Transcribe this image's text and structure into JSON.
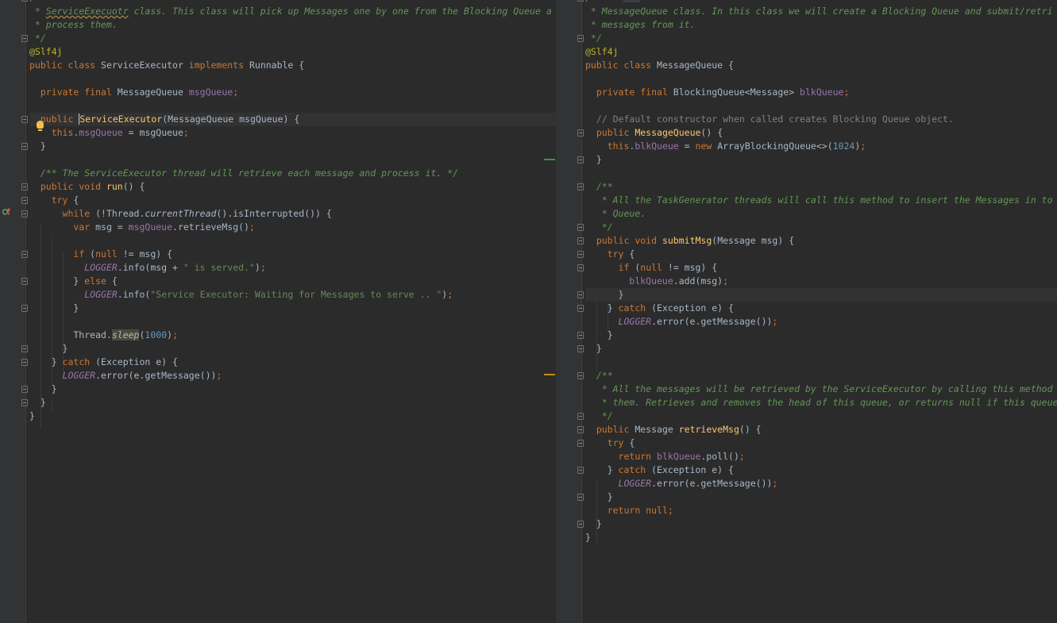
{
  "editor": {
    "left_file": {
      "lines": [
        [
          [
            "lc",
            "/**"
          ]
        ],
        [
          [
            "cm",
            " * "
          ],
          [
            "cm-warn",
            "ServiceExecuotr"
          ],
          [
            "cm",
            " class. This class will pick up Messages one by one from the Blocking Queue a"
          ]
        ],
        [
          [
            "cm",
            " * process them."
          ]
        ],
        [
          [
            "cm",
            " */"
          ]
        ],
        [
          [
            "an",
            "@Slf4j"
          ]
        ],
        [
          [
            "kw",
            "public class "
          ],
          [
            "",
            "ServiceExecutor "
          ],
          [
            "kw",
            "implements "
          ],
          [
            "",
            "Runnable {"
          ]
        ],
        [],
        [
          [
            "",
            "  "
          ],
          [
            "kw",
            "private final "
          ],
          [
            "",
            "MessageQueue "
          ],
          [
            "fd",
            "msgQueue"
          ],
          [
            "kw",
            ";"
          ]
        ],
        [],
        [
          [
            "",
            "  "
          ],
          [
            "kw",
            "public "
          ],
          [
            "caret",
            ""
          ],
          [
            "fnhl",
            "ServiceExecutor"
          ],
          [
            "",
            "(MessageQueue msgQueue) {"
          ]
        ],
        [
          [
            "",
            "    "
          ],
          [
            "kw",
            "this"
          ],
          [
            "",
            "."
          ],
          [
            "fd",
            "msgQueue"
          ],
          [
            "",
            " = msgQueue"
          ],
          [
            "kw",
            ";"
          ]
        ],
        [
          [
            "",
            "  }"
          ]
        ],
        [],
        [
          [
            "",
            "  "
          ],
          [
            "cm",
            "/** The ServiceExecutor thread will retrieve each message and process it. */"
          ]
        ],
        [
          [
            "",
            "  "
          ],
          [
            "kw",
            "public void "
          ],
          [
            "fn",
            "run"
          ],
          [
            "",
            "() {"
          ]
        ],
        [
          [
            "",
            "    "
          ],
          [
            "kw",
            "try "
          ],
          [
            "",
            "{"
          ]
        ],
        [
          [
            "",
            "      "
          ],
          [
            "kw",
            "while "
          ],
          [
            "",
            "(!Thread."
          ],
          [
            "sm",
            "currentThread"
          ],
          [
            "",
            "().isInterrupted()) {"
          ]
        ],
        [
          [
            "",
            "        "
          ],
          [
            "kw",
            "var "
          ],
          [
            "",
            "msg = "
          ],
          [
            "fd",
            "msgQueue"
          ],
          [
            "",
            ".retrieveMsg()"
          ],
          [
            "kw",
            ";"
          ]
        ],
        [],
        [
          [
            "",
            "        "
          ],
          [
            "kw",
            "if "
          ],
          [
            "",
            "("
          ],
          [
            "kw",
            "null "
          ],
          [
            "",
            "!= msg) {"
          ]
        ],
        [
          [
            "",
            "          "
          ],
          [
            "st",
            "LOGGER"
          ],
          [
            "",
            ".info(msg + "
          ],
          [
            "str",
            "\" is served.\""
          ],
          [
            "",
            ")"
          ],
          [
            "kw",
            ";"
          ]
        ],
        [
          [
            "",
            "        } "
          ],
          [
            "kw",
            "else "
          ],
          [
            "",
            "{"
          ]
        ],
        [
          [
            "",
            "          "
          ],
          [
            "st",
            "LOGGER"
          ],
          [
            "",
            ".info("
          ],
          [
            "str",
            "\"Service Executor: Waiting for Messages to serve .. \""
          ],
          [
            "",
            ")"
          ],
          [
            "kw",
            ";"
          ]
        ],
        [
          [
            "",
            "        }"
          ]
        ],
        [],
        [
          [
            "",
            "        Thread."
          ],
          [
            "smhl",
            "sleep"
          ],
          [
            "",
            "("
          ],
          [
            "num",
            "1000"
          ],
          [
            "",
            ")"
          ],
          [
            "kw",
            ";"
          ]
        ],
        [
          [
            "",
            "      }"
          ]
        ],
        [
          [
            "",
            "    } "
          ],
          [
            "kw",
            "catch "
          ],
          [
            "",
            "(Exception e) {"
          ]
        ],
        [
          [
            "",
            "      "
          ],
          [
            "st",
            "LOGGER"
          ],
          [
            "",
            ".error(e.getMessage())"
          ],
          [
            "kw",
            ";"
          ]
        ],
        [
          [
            "",
            "    }"
          ]
        ],
        [
          [
            "",
            "  }"
          ]
        ],
        [
          [
            "",
            "}"
          ]
        ]
      ]
    },
    "right_file": {
      "lines": [
        [
          [
            "lc",
            "/**"
          ]
        ],
        [
          [
            "cm",
            " * MessageQueue class. In this class we will create a Blocking Queue and submit/retri"
          ]
        ],
        [
          [
            "cm",
            " * messages from it."
          ]
        ],
        [
          [
            "cm",
            " */"
          ]
        ],
        [
          [
            "an",
            "@Slf4j"
          ]
        ],
        [
          [
            "kw",
            "public class "
          ],
          [
            "",
            "MessageQueue {"
          ]
        ],
        [],
        [
          [
            "",
            "  "
          ],
          [
            "kw",
            "private final "
          ],
          [
            "",
            "BlockingQueue<Message> "
          ],
          [
            "fd",
            "blkQueue"
          ],
          [
            "kw",
            ";"
          ]
        ],
        [],
        [
          [
            "",
            "  "
          ],
          [
            "lc",
            "// Default constructor when called creates Blocking Queue object."
          ]
        ],
        [
          [
            "",
            "  "
          ],
          [
            "kw",
            "public "
          ],
          [
            "fn",
            "MessageQueue"
          ],
          [
            "",
            "() {"
          ]
        ],
        [
          [
            "",
            "    "
          ],
          [
            "kw",
            "this"
          ],
          [
            "",
            "."
          ],
          [
            "fd",
            "blkQueue"
          ],
          [
            "",
            " = "
          ],
          [
            "kw",
            "new "
          ],
          [
            "",
            "ArrayBlockingQueue<>("
          ],
          [
            "num",
            "1024"
          ],
          [
            "",
            ")"
          ],
          [
            "kw",
            ";"
          ]
        ],
        [
          [
            "",
            "  }"
          ]
        ],
        [],
        [
          [
            "",
            "  "
          ],
          [
            "cm",
            "/**"
          ]
        ],
        [
          [
            "",
            "  "
          ],
          [
            "cm",
            " * All the TaskGenerator threads will call this method to insert the Messages in to"
          ]
        ],
        [
          [
            "",
            "  "
          ],
          [
            "cm",
            " * Queue."
          ]
        ],
        [
          [
            "",
            "  "
          ],
          [
            "cm",
            " */"
          ]
        ],
        [
          [
            "",
            "  "
          ],
          [
            "kw",
            "public void "
          ],
          [
            "fn",
            "submitMsg"
          ],
          [
            "",
            "(Message msg) {"
          ]
        ],
        [
          [
            "",
            "    "
          ],
          [
            "kw",
            "try "
          ],
          [
            "",
            "{"
          ]
        ],
        [
          [
            "",
            "      "
          ],
          [
            "kw",
            "if "
          ],
          [
            "",
            "("
          ],
          [
            "kw",
            "null "
          ],
          [
            "",
            "!= msg) {"
          ]
        ],
        [
          [
            "",
            "        "
          ],
          [
            "fd",
            "blkQueue"
          ],
          [
            "",
            ".add(msg)"
          ],
          [
            "kw",
            ";"
          ]
        ],
        [
          [
            "",
            "      }"
          ]
        ],
        [
          [
            "",
            "    } "
          ],
          [
            "kw",
            "catch "
          ],
          [
            "",
            "(Exception e) {"
          ]
        ],
        [
          [
            "",
            "      "
          ],
          [
            "st",
            "LOGGER"
          ],
          [
            "",
            ".error(e.getMessage())"
          ],
          [
            "kw",
            ";"
          ]
        ],
        [
          [
            "",
            "    }"
          ]
        ],
        [
          [
            "",
            "  }"
          ]
        ],
        [],
        [
          [
            "",
            "  "
          ],
          [
            "cm",
            "/**"
          ]
        ],
        [
          [
            "",
            "  "
          ],
          [
            "cm",
            " * All the messages will be retrieved by the ServiceExecutor by calling this method"
          ]
        ],
        [
          [
            "",
            "  "
          ],
          [
            "cm",
            " * them. Retrieves and removes the head of this queue, or returns null if this queue"
          ]
        ],
        [
          [
            "",
            "  "
          ],
          [
            "cm",
            " */"
          ]
        ],
        [
          [
            "",
            "  "
          ],
          [
            "kw",
            "public "
          ],
          [
            "",
            "Message "
          ],
          [
            "fn",
            "retrieveMsg"
          ],
          [
            "",
            "() {"
          ]
        ],
        [
          [
            "",
            "    "
          ],
          [
            "kw",
            "try "
          ],
          [
            "",
            "{"
          ]
        ],
        [
          [
            "",
            "      "
          ],
          [
            "kw",
            "return "
          ],
          [
            "fd",
            "blkQueue"
          ],
          [
            "",
            ".poll()"
          ],
          [
            "kw",
            ";"
          ]
        ],
        [
          [
            "",
            "    } "
          ],
          [
            "kw",
            "catch "
          ],
          [
            "",
            "(Exception e) {"
          ]
        ],
        [
          [
            "",
            "      "
          ],
          [
            "st",
            "LOGGER"
          ],
          [
            "",
            ".error(e.getMessage())"
          ],
          [
            "kw",
            ";"
          ]
        ],
        [
          [
            "",
            "    }"
          ]
        ],
        [
          [
            "",
            "    "
          ],
          [
            "kw",
            "return null;"
          ]
        ],
        [
          [
            "",
            "  }"
          ]
        ],
        [
          [
            "",
            "}"
          ]
        ]
      ]
    }
  }
}
